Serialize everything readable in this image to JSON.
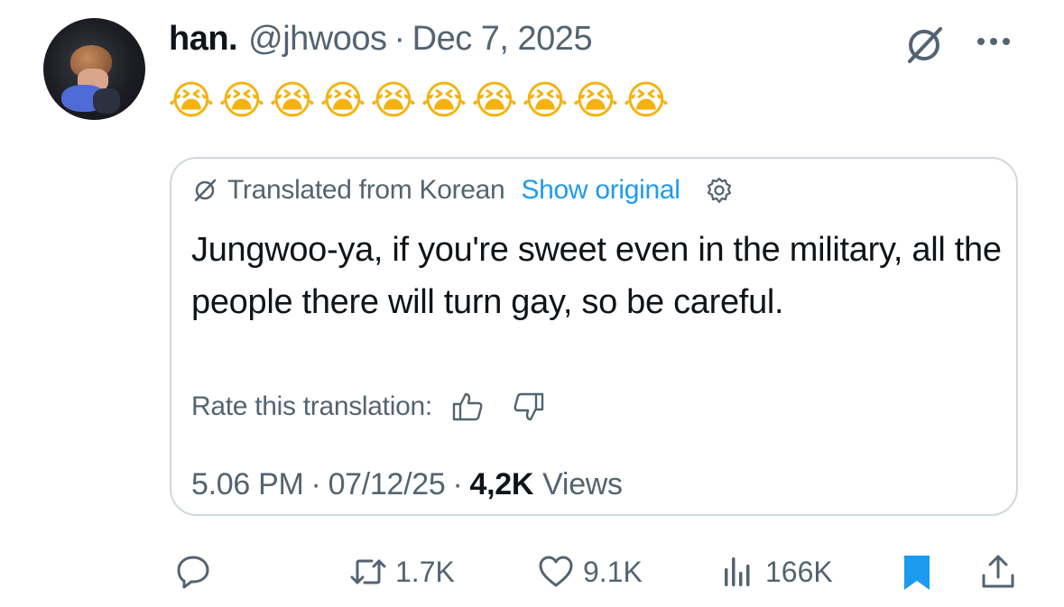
{
  "tweet": {
    "display_name": "han.",
    "handle": "@jhwoos",
    "separator": "·",
    "date": "Dec 7, 2025",
    "emoji_text": [
      "😭",
      "😭",
      "😭",
      "😭",
      "😭",
      "😭",
      "😭",
      "😭",
      "😭",
      "😭"
    ]
  },
  "translation": {
    "label": "Translated from Korean",
    "show_original": "Show original",
    "text": "Jungwoo-ya, if you're sweet even in the military, all the people there will turn gay, so be careful.",
    "rate_label": "Rate this translation:"
  },
  "meta": {
    "time": "5.06 PM",
    "date": "07/12/25",
    "dot": "·",
    "views_count": "4,2K",
    "views_label": "Views"
  },
  "actions": {
    "retweets": "1.7K",
    "likes": "9.1K",
    "views": "166K"
  },
  "colors": {
    "accent": "#1d9bf0",
    "secondary_text": "#536471",
    "primary_text": "#0f1419",
    "border": "#cfd9de",
    "emoji": "#f5b20f"
  }
}
